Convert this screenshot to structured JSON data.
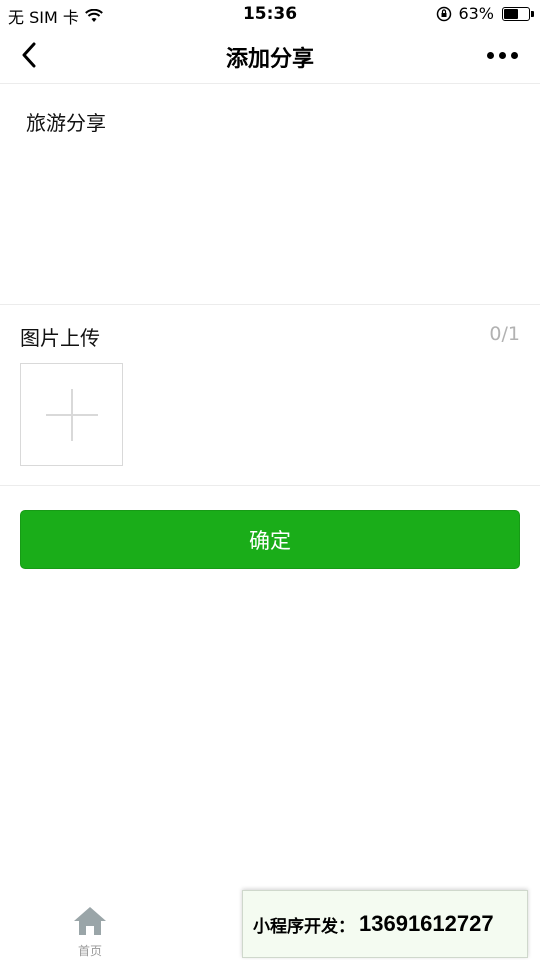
{
  "status_bar": {
    "carrier": "无 SIM 卡",
    "time": "15:36",
    "battery_percent": "63%",
    "battery_level": 0.63
  },
  "nav": {
    "title": "添加分享"
  },
  "content": {
    "text": "旅游分享"
  },
  "upload": {
    "title": "图片上传",
    "count": "0/1"
  },
  "confirm_label": "确定",
  "tabbar": {
    "home_label": "首页"
  },
  "promo": {
    "label": "小程序开发：",
    "number": "13691612727"
  }
}
